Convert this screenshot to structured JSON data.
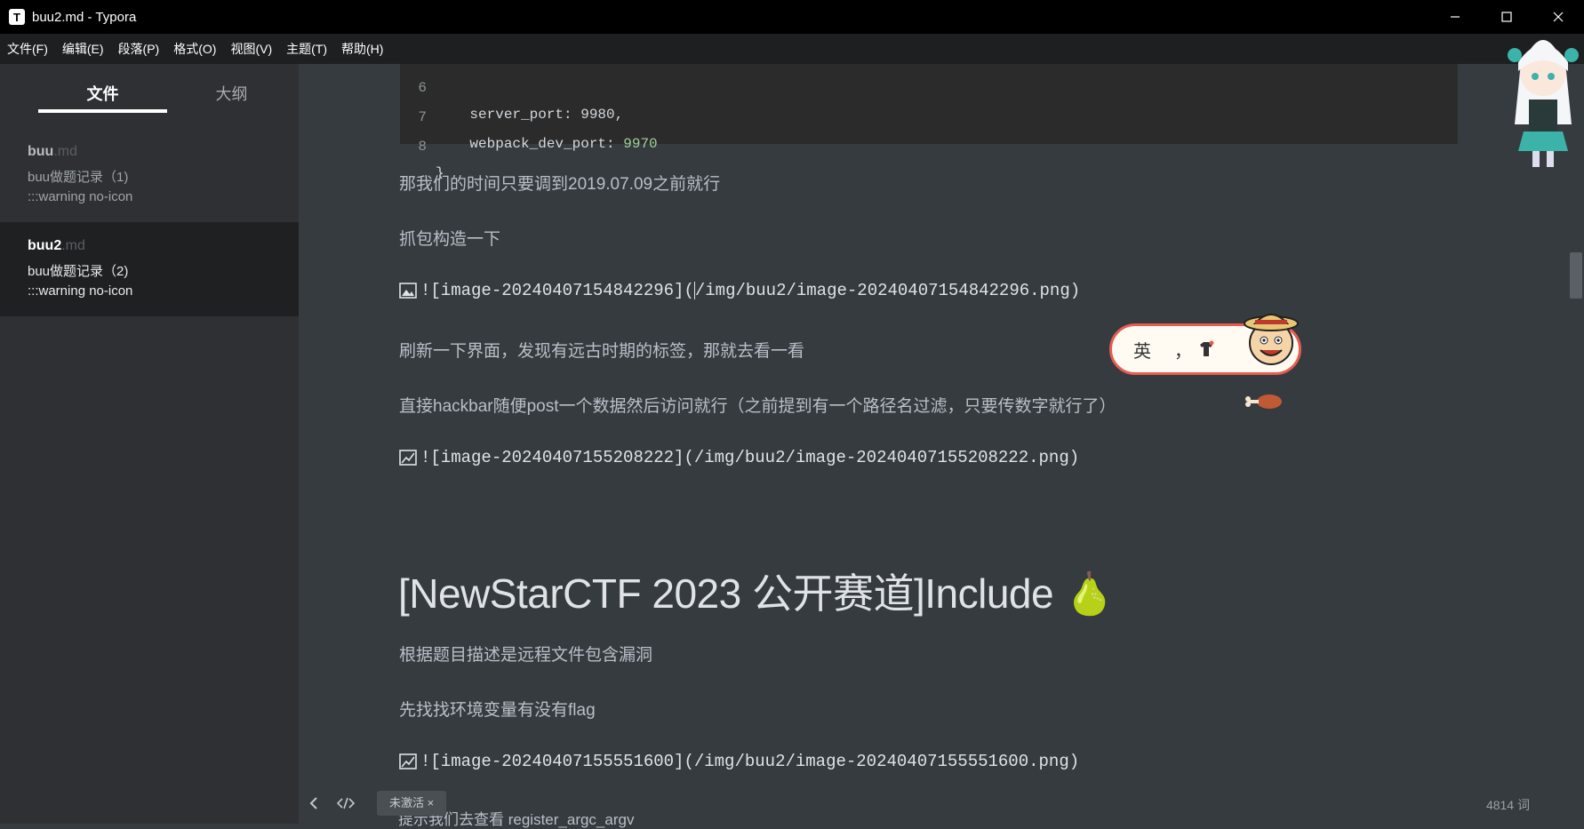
{
  "window": {
    "title": "buu2.md - Typora",
    "app_icon": "T",
    "controls": [
      "minimize-icon",
      "maximize-icon",
      "close-icon"
    ]
  },
  "menu": [
    "文件(F)",
    "编辑(E)",
    "段落(P)",
    "格式(O)",
    "视图(V)",
    "主题(T)",
    "帮助(H)"
  ],
  "sidebar": {
    "tabs": [
      "文件",
      "大纲"
    ],
    "active_tab": "文件",
    "files": [
      {
        "name": "buu",
        "ext": ".md",
        "line1": "buu做题记录（1)",
        "line2": ":::warning no-icon",
        "active": false
      },
      {
        "name": "buu2",
        "ext": ".md",
        "line1": "buu做题记录（2)",
        "line2": ":::warning no-icon",
        "active": true
      }
    ]
  },
  "editor": {
    "code": {
      "partial_line": {
        "num": "6",
        "text": "    server_port: 9980,"
      },
      "lines": [
        {
          "num": "7",
          "key": "    webpack_dev_port: ",
          "value": "9970"
        },
        {
          "num": "8",
          "key": "}",
          "value": ""
        }
      ]
    },
    "paragraphs": {
      "p1": "那我们的时间只要调到2019.07.09之前就行",
      "p2": "抓包构造一下",
      "p3": "刷新一下界面，发现有远古时期的标签，那就去看一看",
      "p4": "直接hackbar随便post一个数据然后访问就行（之前提到有一个路径名过滤，只要传数字就行了）",
      "p5": "根据题目描述是远程文件包含漏洞",
      "p6": "先找找环境变量有没有flag"
    },
    "images": {
      "img1_a": "![image-20240407154842296](",
      "img1_b": "/img/buu2/image-20240407154842296.png)",
      "img2": "![image-20240407155208222](/img/buu2/image-20240407155208222.png)",
      "img3": "![image-20240407155551600](/img/buu2/image-20240407155551600.png)"
    },
    "heading": "[NewStarCTF 2023 公开赛道]Include 🍐",
    "next_line_peek": "提示我们去查看 register_argc_argv"
  },
  "ime": {
    "mode": "英",
    "punct": "，"
  },
  "footer": {
    "tag": "未激活 ×",
    "word_count": "4814 词"
  }
}
